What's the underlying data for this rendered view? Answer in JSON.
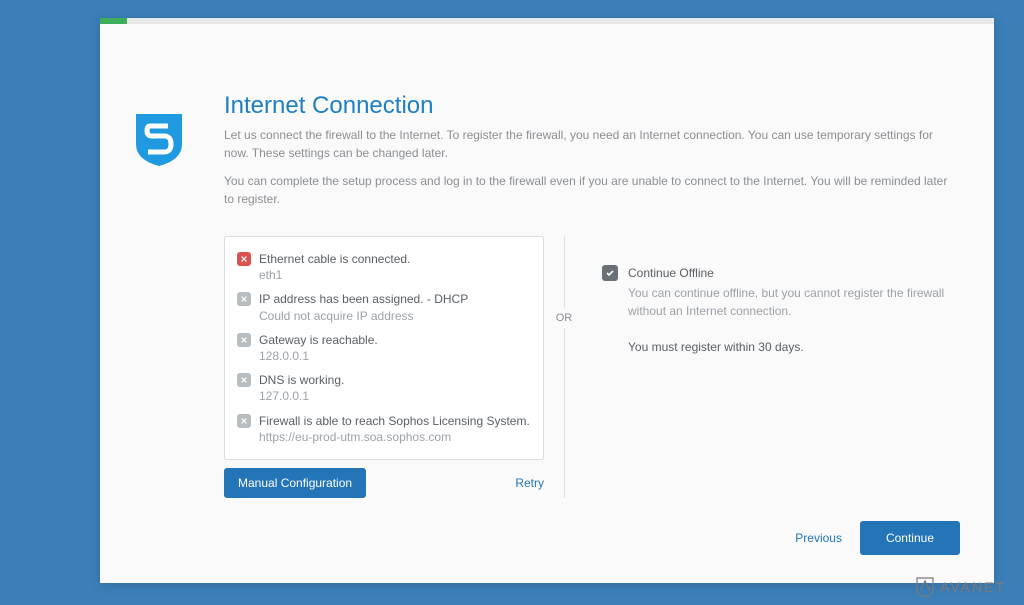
{
  "header": {
    "title": "Internet Connection",
    "intro1": "Let us connect the firewall to the Internet. To register the firewall, you need an Internet connection. You can use temporary settings for now. These settings can be changed later.",
    "intro2": "You can complete the setup process and log in to the firewall even if you are unable to connect to the Internet. You will be reminded later to register."
  },
  "status": [
    {
      "kind": "error",
      "label": "Ethernet cable is connected.",
      "detail": "eth1"
    },
    {
      "kind": "neutral",
      "label": "IP address has been assigned. - DHCP",
      "detail": "Could not acquire IP address"
    },
    {
      "kind": "neutral",
      "label": "Gateway is reachable.",
      "detail": "128.0.0.1"
    },
    {
      "kind": "neutral",
      "label": "DNS is working.",
      "detail": "127.0.0.1"
    },
    {
      "kind": "neutral",
      "label": "Firewall is able to reach Sophos Licensing System.",
      "detail": "https://eu-prod-utm.soa.sophos.com"
    }
  ],
  "buttons": {
    "manual": "Manual Configuration",
    "retry": "Retry",
    "previous": "Previous",
    "continue": "Continue"
  },
  "divider": {
    "or": "OR"
  },
  "offline": {
    "title": "Continue Offline",
    "desc": "You can continue offline, but you cannot register the firewall without an Internet connection.",
    "note": "You must register within 30 days."
  },
  "watermark": {
    "brand": "AVANET"
  }
}
